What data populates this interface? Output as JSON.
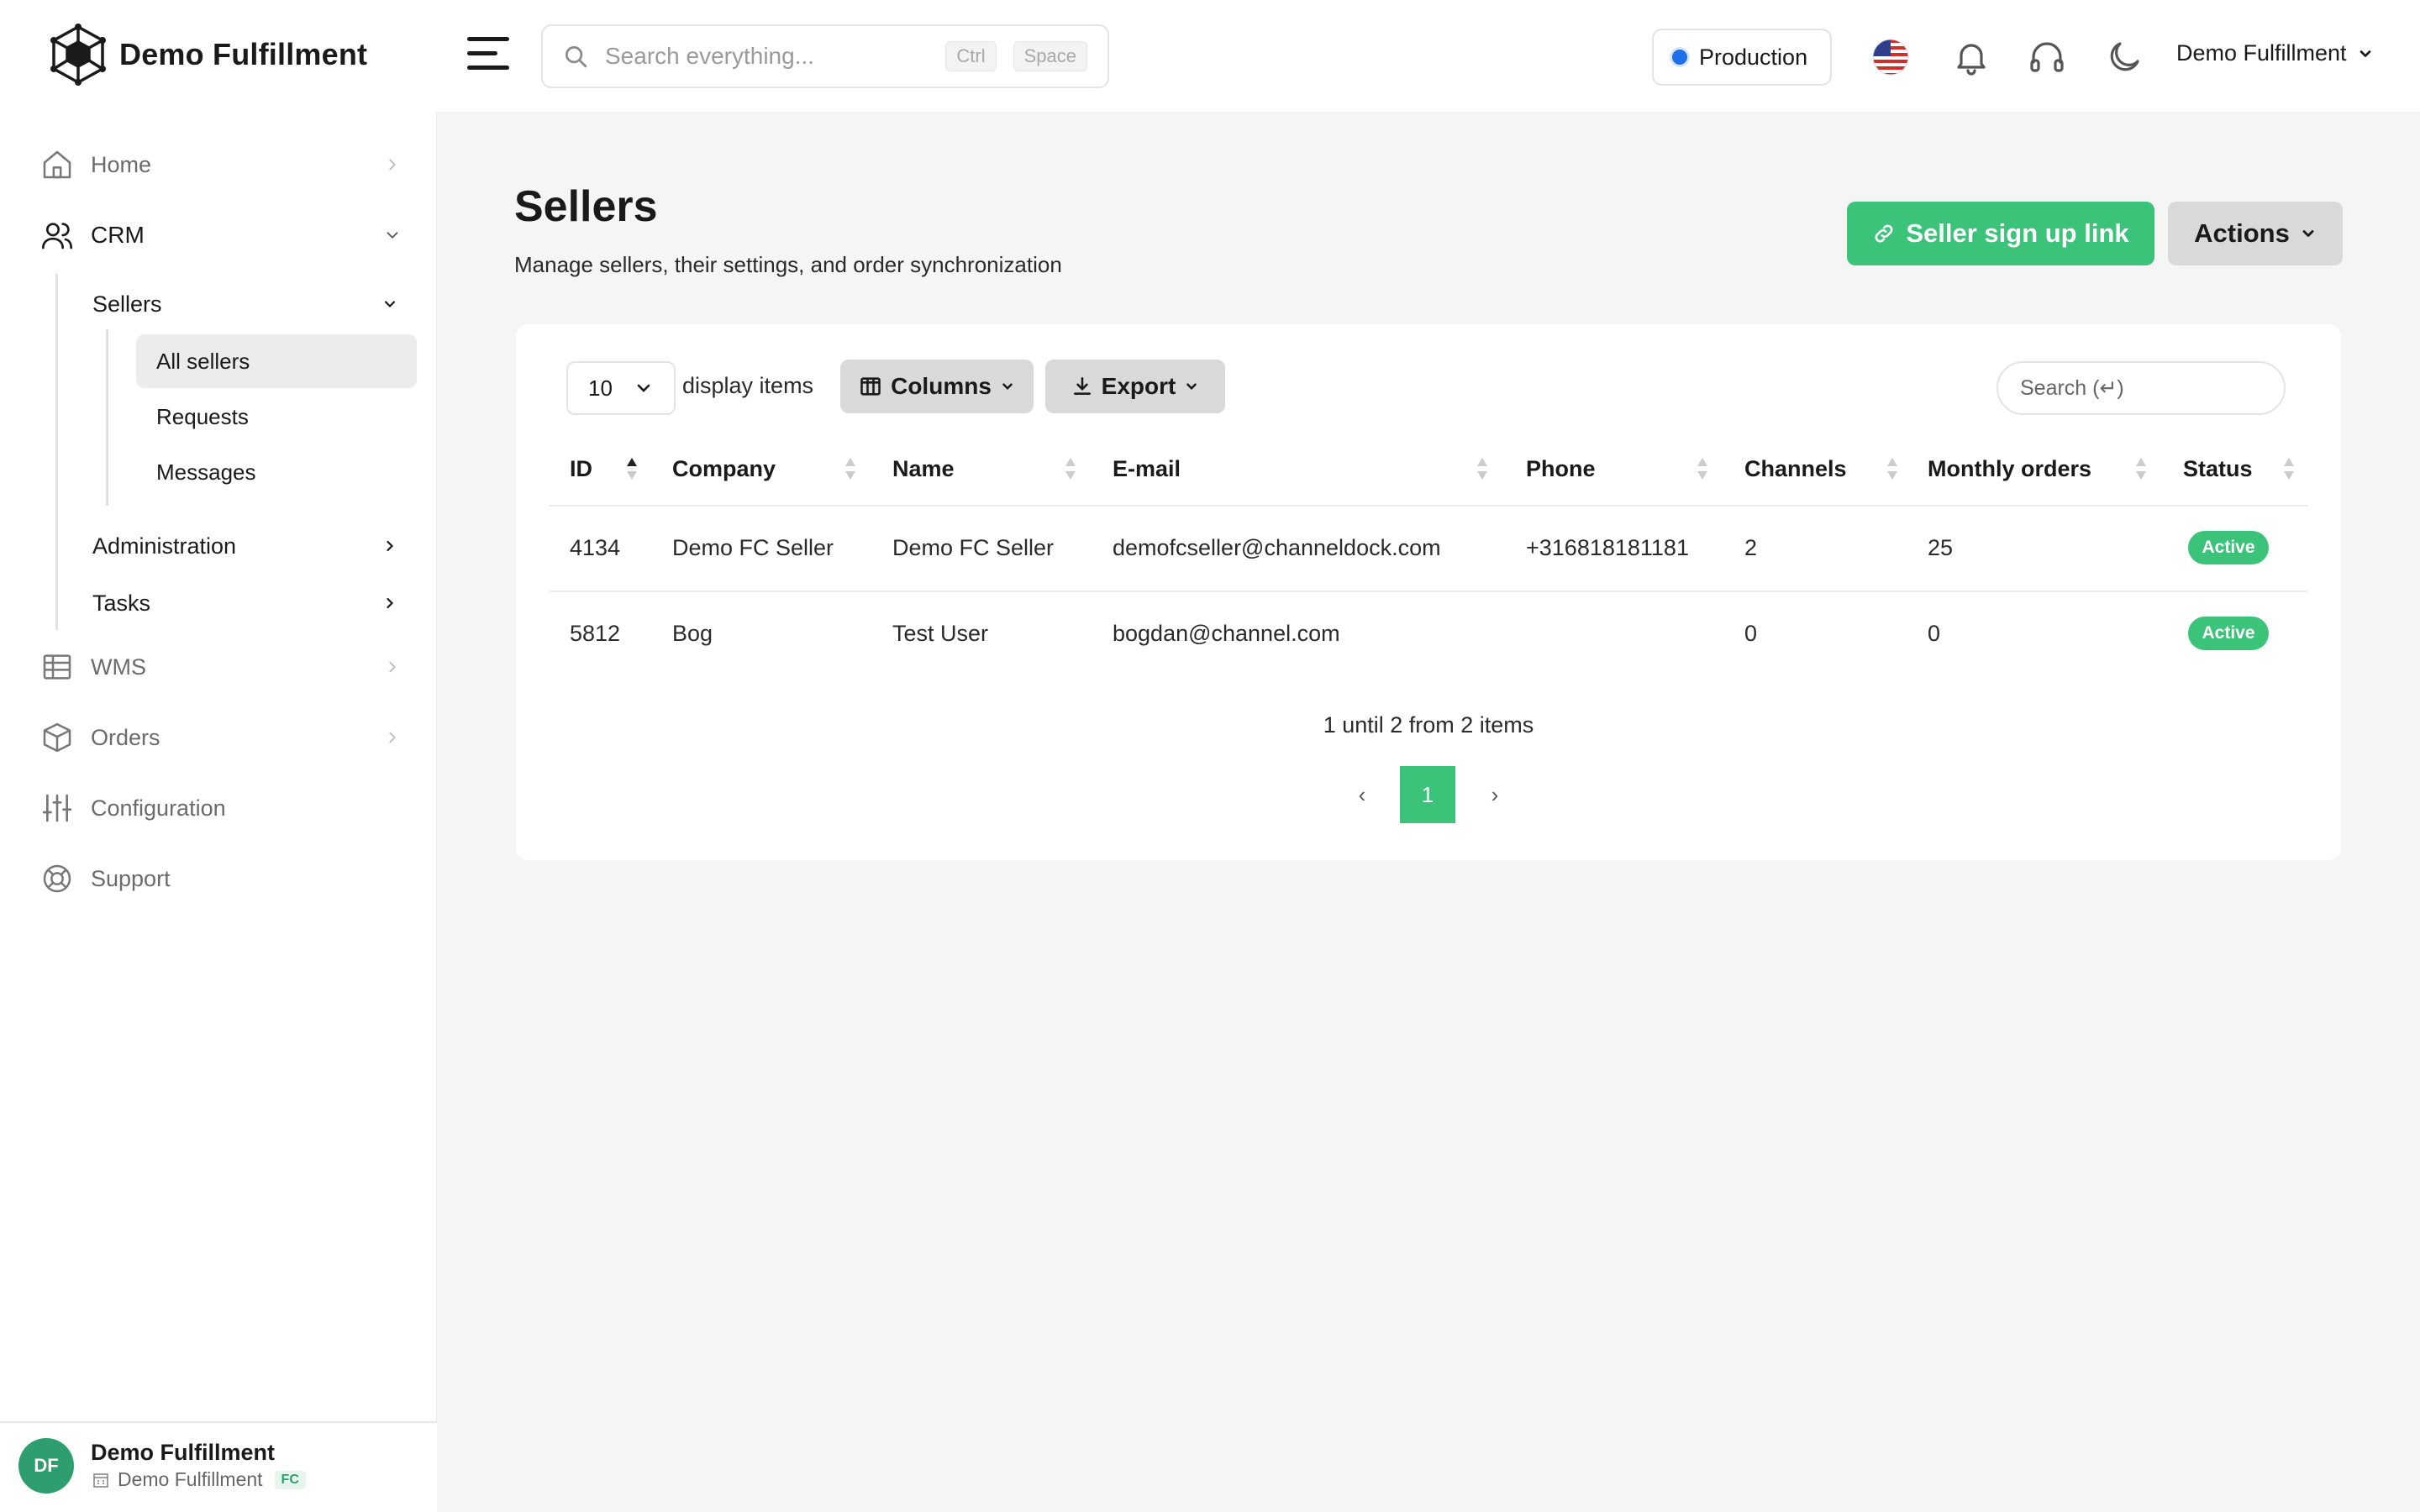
{
  "brand": {
    "name": "Demo Fulfillment"
  },
  "header": {
    "search_placeholder": "Search everything...",
    "kbd_ctrl": "Ctrl",
    "kbd_space": "Space",
    "environment": "Production",
    "user_name": "Demo Fulfillment"
  },
  "sidebar": {
    "home": "Home",
    "crm": "CRM",
    "sellers": "Sellers",
    "all_sellers": "All sellers",
    "requests": "Requests",
    "messages": "Messages",
    "administration": "Administration",
    "tasks": "Tasks",
    "wms": "WMS",
    "orders": "Orders",
    "configuration": "Configuration",
    "support": "Support"
  },
  "footer": {
    "initials": "DF",
    "name": "Demo Fulfillment",
    "sub": "Demo Fulfillment",
    "badge": "FC"
  },
  "page": {
    "title": "Sellers",
    "subtitle": "Manage sellers, their settings, and order synchronization",
    "signup_button": "Seller sign up link",
    "actions_button": "Actions"
  },
  "table_controls": {
    "per_page": "10",
    "per_page_label": "display items",
    "columns_button": "Columns",
    "export_button": "Export",
    "search_placeholder": "Search (↵)"
  },
  "table": {
    "columns": [
      "ID",
      "Company",
      "Name",
      "E-mail",
      "Phone",
      "Channels",
      "Monthly orders",
      "Status"
    ],
    "rows": [
      {
        "id": "4134",
        "company": "Demo FC Seller",
        "name": "Demo FC Seller",
        "email": "demofcseller@channeldock.com",
        "phone": "+316818181181",
        "channels": "2",
        "monthly_orders": "25",
        "status": "Active"
      },
      {
        "id": "5812",
        "company": "Bog",
        "name": "Test User",
        "email": "bogdan@channel.com",
        "phone": "",
        "channels": "0",
        "monthly_orders": "0",
        "status": "Active"
      }
    ]
  },
  "pagination": {
    "info": "1 until 2 from 2 items",
    "prev": "‹",
    "current": "1",
    "next": "›"
  },
  "colors": {
    "accent_green": "#3cc37a",
    "env_dot": "#1f6feb",
    "avatar": "#2f9e6e"
  }
}
